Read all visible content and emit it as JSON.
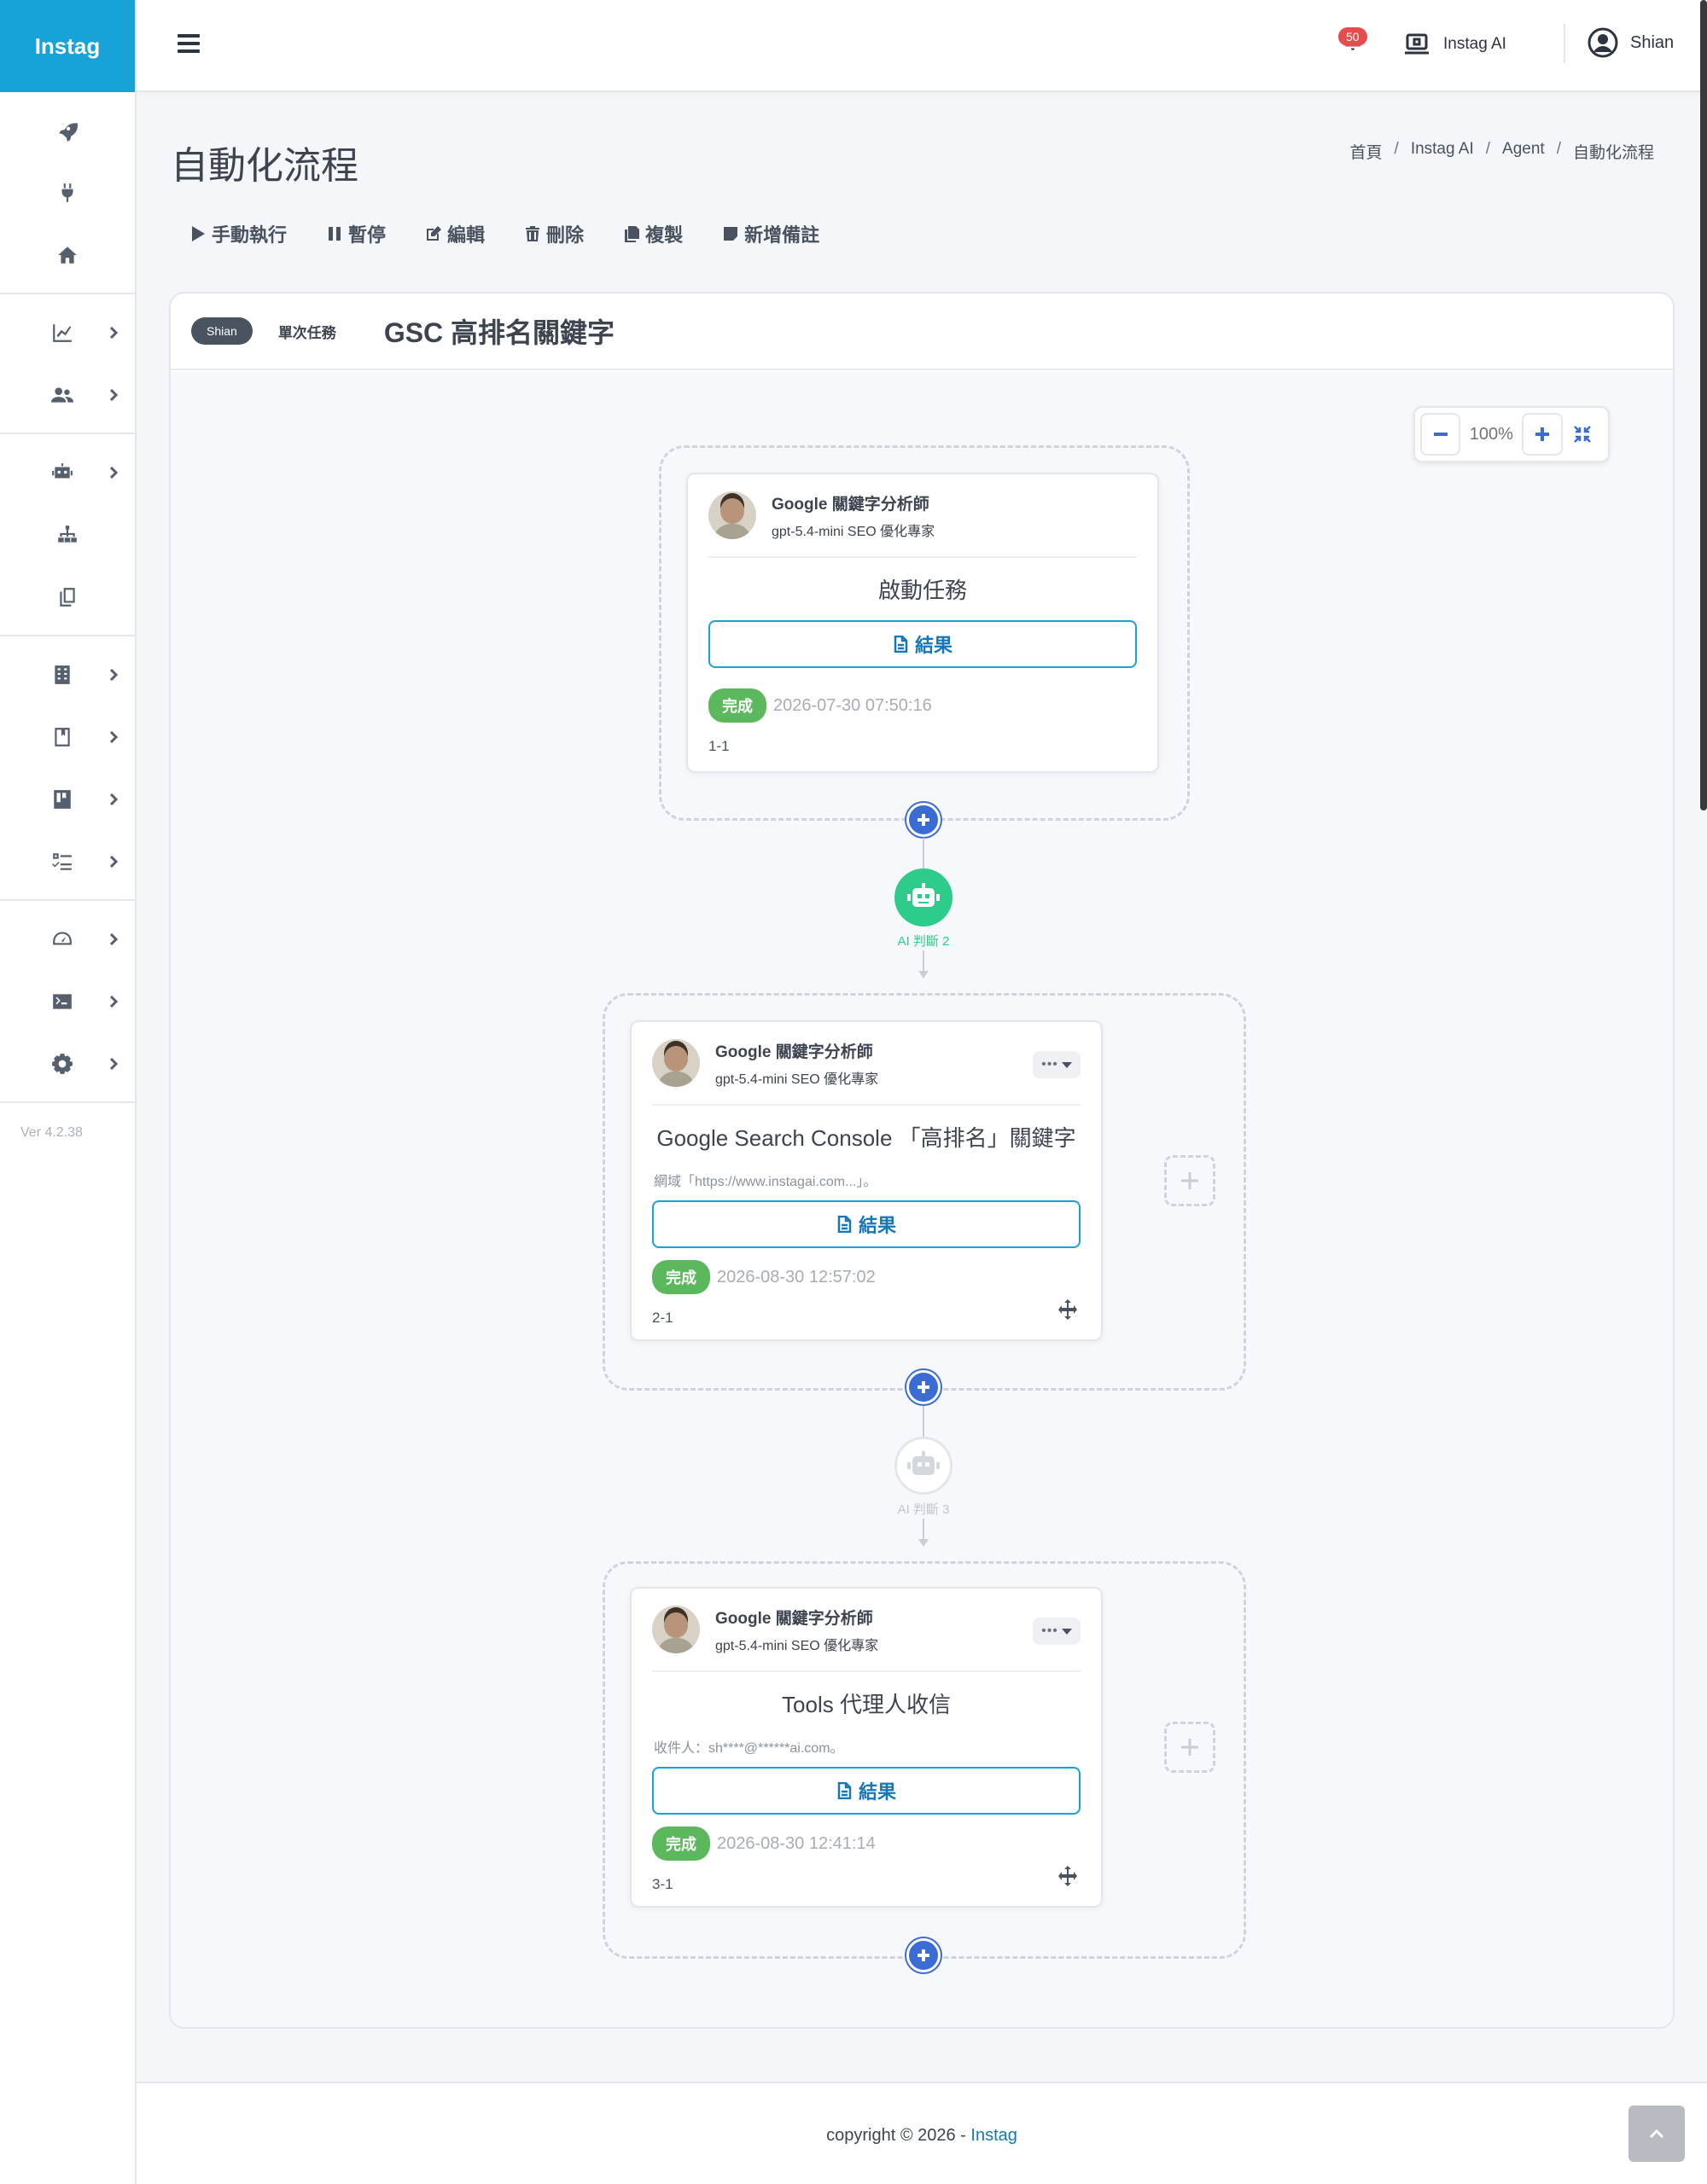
{
  "app": {
    "brand": "Instag",
    "version": "Ver 4.2.38"
  },
  "topbar": {
    "notification_count": "50",
    "ai_label": "Instag AI",
    "user_name": "Shian"
  },
  "sidebar": {
    "items": [
      {
        "icon": "rocket-icon",
        "has_submenu": false
      },
      {
        "icon": "plug-icon",
        "has_submenu": false
      },
      {
        "icon": "home-icon",
        "has_submenu": false
      },
      {
        "icon": "chart-line-icon",
        "has_submenu": true
      },
      {
        "icon": "users-icon",
        "has_submenu": true
      },
      {
        "icon": "robot-icon",
        "has_submenu": true
      },
      {
        "icon": "sitemap-icon",
        "has_submenu": false
      },
      {
        "icon": "copy-icon",
        "has_submenu": false
      },
      {
        "icon": "building-icon",
        "has_submenu": true
      },
      {
        "icon": "bookmark-book-icon",
        "has_submenu": true
      },
      {
        "icon": "book-icon",
        "has_submenu": true
      },
      {
        "icon": "checklist-icon",
        "has_submenu": true
      },
      {
        "icon": "gauge-icon",
        "has_submenu": true
      },
      {
        "icon": "terminal-icon",
        "has_submenu": true
      },
      {
        "icon": "gear-icon",
        "has_submenu": true
      }
    ]
  },
  "page": {
    "title": "自動化流程",
    "breadcrumb": [
      "首頁",
      "Instag AI",
      "Agent",
      "自動化流程"
    ]
  },
  "toolbar": {
    "run": "手動執行",
    "pause": "暫停",
    "edit": "編輯",
    "delete": "刪除",
    "copy": "複製",
    "note": "新增備註"
  },
  "flow": {
    "owner": "Shian",
    "task_type": "單次任務",
    "name": "GSC 高排名關鍵字",
    "zoom": "100%",
    "nodes": [
      {
        "agent_name": "Google 關鍵字分析師",
        "agent_sub": "gpt-5.4-mini SEO 優化專家",
        "title": "啟動任務",
        "desc": "",
        "result_label": "結果",
        "status": "完成",
        "time": "2026-07-30 07:50:16",
        "id": "1-1"
      },
      {
        "agent_name": "Google 關鍵字分析師",
        "agent_sub": "gpt-5.4-mini SEO 優化專家",
        "title": "Google Search Console 「高排名」關鍵字",
        "desc": "網域「https://www.instagai.com...」。",
        "result_label": "結果",
        "status": "完成",
        "time": "2026-08-30 12:57:02",
        "id": "2-1"
      },
      {
        "agent_name": "Google 關鍵字分析師",
        "agent_sub": "gpt-5.4-mini SEO 優化專家",
        "title": "Tools 代理人收信",
        "desc": "收件人：sh****@******ai.com。",
        "result_label": "結果",
        "status": "完成",
        "time": "2026-08-30 12:41:14",
        "id": "3-1"
      }
    ],
    "ai_judges": [
      {
        "label": "AI 判斷 2",
        "active": true
      },
      {
        "label": "AI 判斷 3",
        "active": false
      }
    ]
  },
  "footer": {
    "copyright": "copyright © 2026 - ",
    "brand": "Instag"
  },
  "colors": {
    "brand": "#17a2d8",
    "success": "#5cb85c",
    "primary": "#3b6cd4",
    "ai_active": "#2ecc8a"
  }
}
